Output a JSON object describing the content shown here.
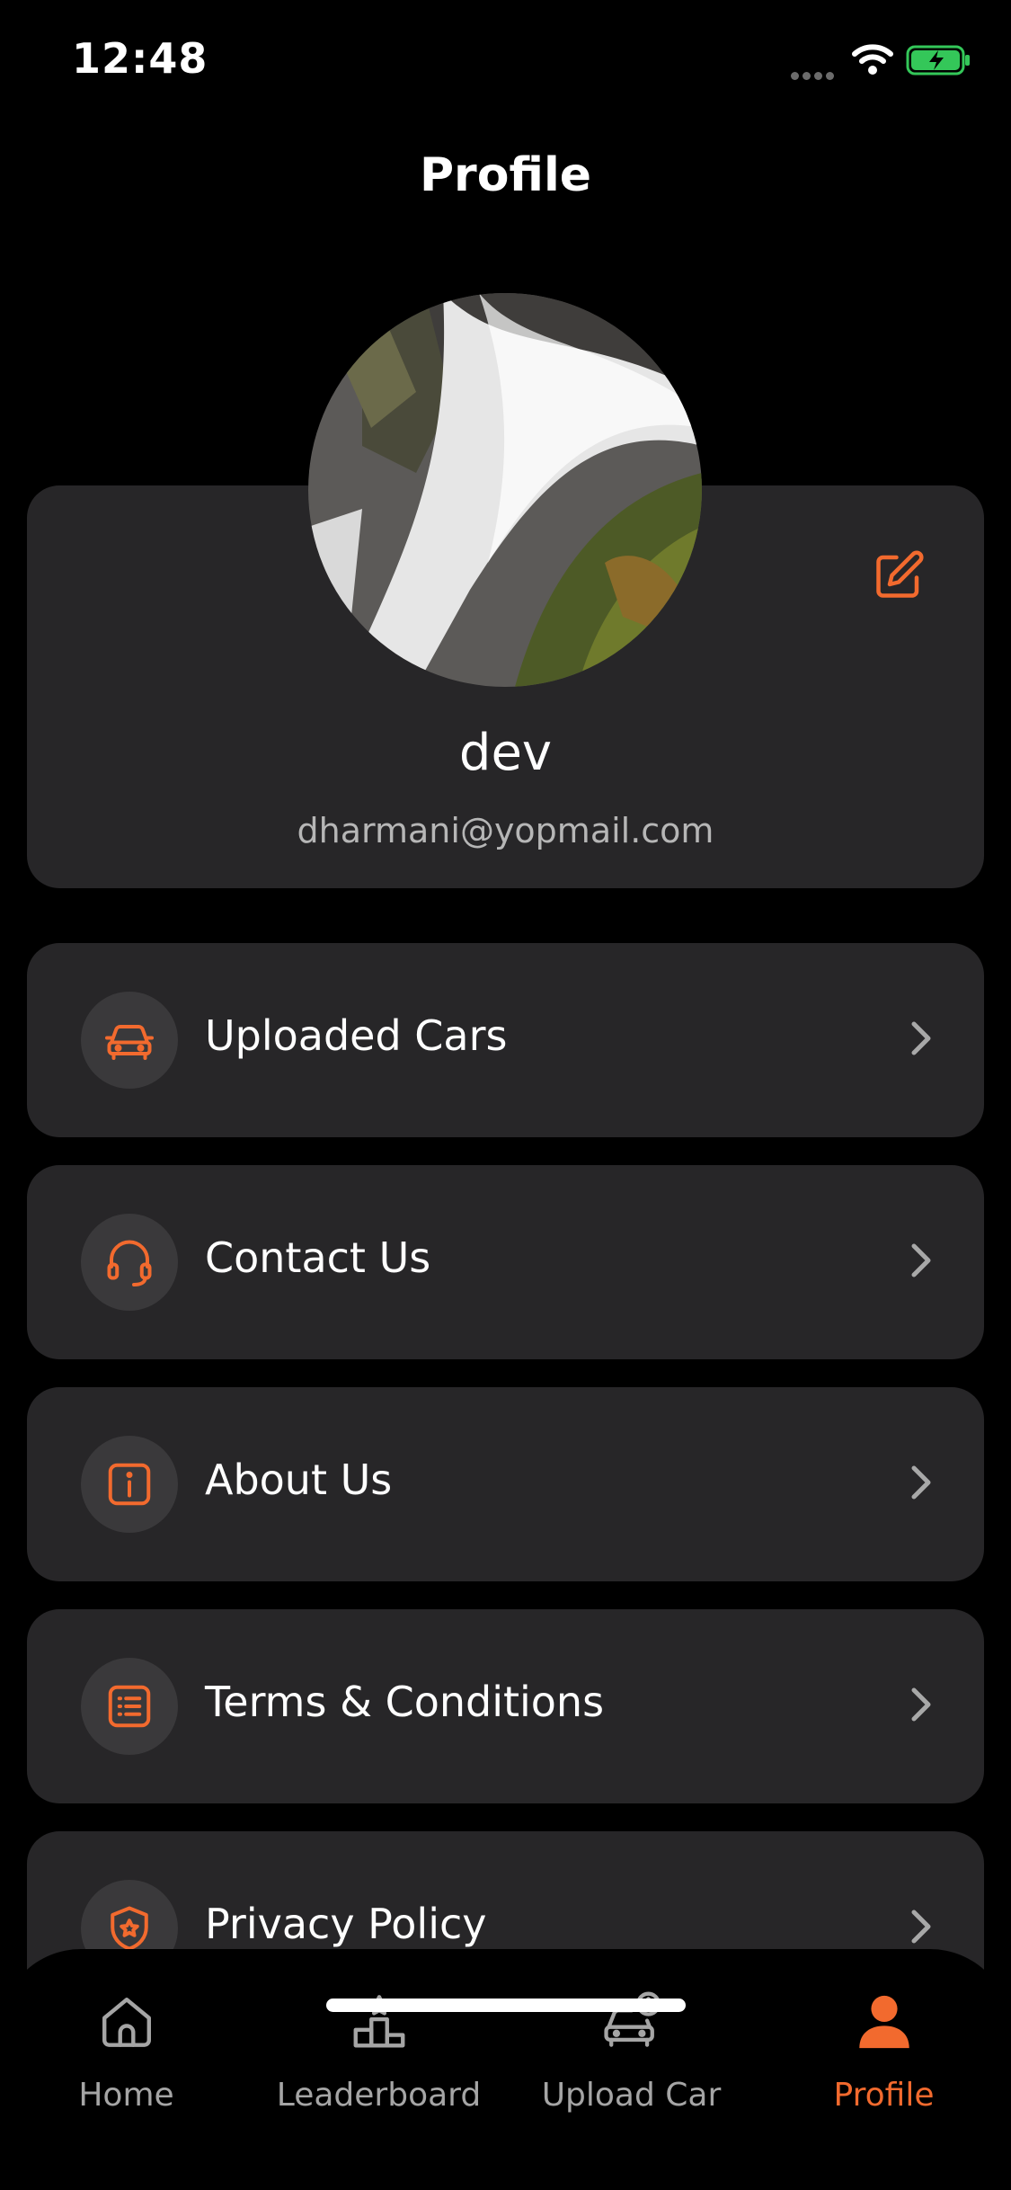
{
  "status_bar": {
    "time": "12:48"
  },
  "header": {
    "title": "Profile"
  },
  "profile": {
    "name": "dev",
    "email": "dharmani@yopmail.com"
  },
  "menu": [
    {
      "label": "Uploaded Cars",
      "icon": "car-icon"
    },
    {
      "label": "Contact Us",
      "icon": "headset-icon"
    },
    {
      "label": "About Us",
      "icon": "info-icon"
    },
    {
      "label": "Terms & Conditions",
      "icon": "list-icon"
    },
    {
      "label": "Privacy Policy",
      "icon": "shield-icon"
    }
  ],
  "tabs": [
    {
      "label": "Home",
      "icon": "home-icon",
      "active": false
    },
    {
      "label": "Leaderboard",
      "icon": "leaderboard-icon",
      "active": false
    },
    {
      "label": "Upload Car",
      "icon": "upload-car-icon",
      "active": false
    },
    {
      "label": "Profile",
      "icon": "profile-icon",
      "active": true
    }
  ],
  "colors": {
    "accent": "#F26A2E",
    "card": "#272628",
    "background": "#000000",
    "battery": "#34C759"
  }
}
